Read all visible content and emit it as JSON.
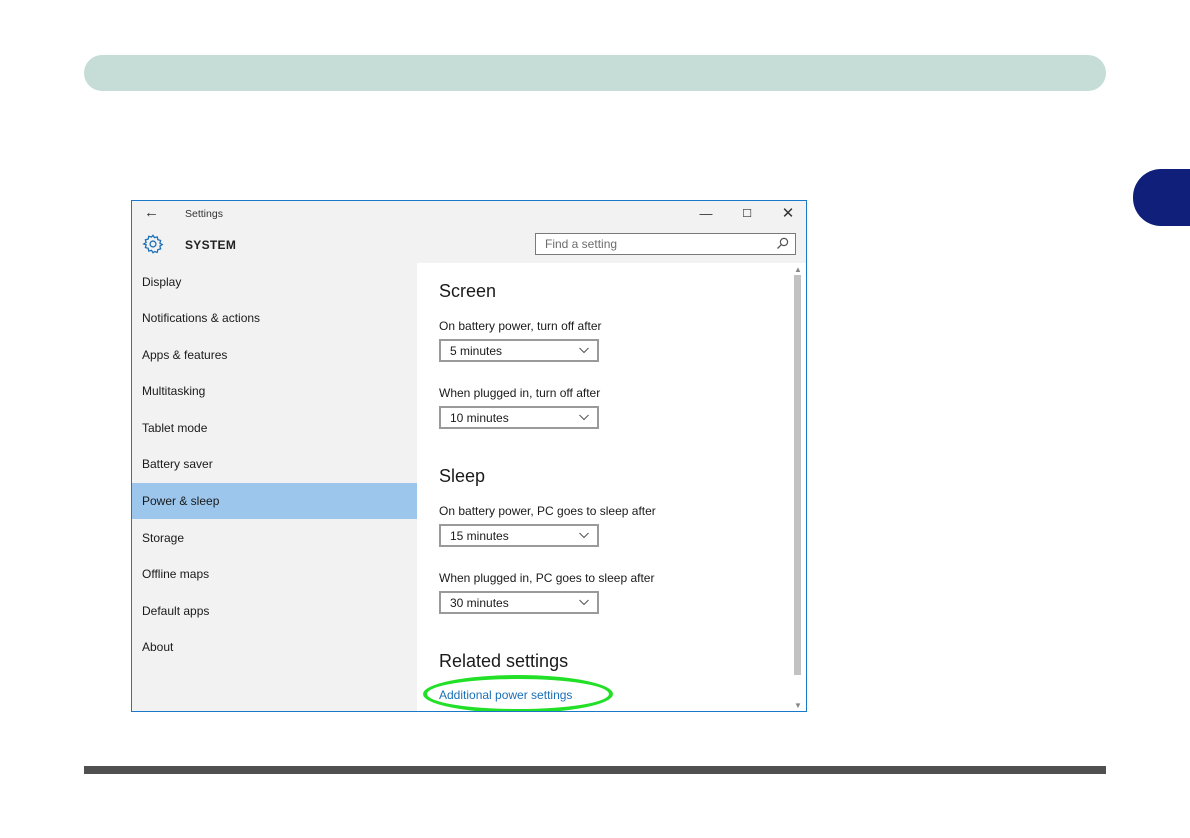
{
  "colors": {
    "top_bar": "#c5dcd7",
    "side_tab": "#0f1f7a",
    "window_border": "#1a78c8",
    "active_nav": "#9cc6ec",
    "link": "#1a6fb8",
    "highlight": "#22e027"
  },
  "window": {
    "title": "Settings",
    "back_icon": "arrow-left-icon",
    "minimize_glyph": "—",
    "maximize_glyph": "☐",
    "close_glyph": "✕"
  },
  "header": {
    "icon": "gear-icon",
    "section": "SYSTEM",
    "search": {
      "placeholder": "Find a setting",
      "value": ""
    }
  },
  "sidebar": {
    "active_index": 6,
    "items": [
      {
        "label": "Display"
      },
      {
        "label": "Notifications & actions"
      },
      {
        "label": "Apps & features"
      },
      {
        "label": "Multitasking"
      },
      {
        "label": "Tablet mode"
      },
      {
        "label": "Battery saver"
      },
      {
        "label": "Power & sleep"
      },
      {
        "label": "Storage"
      },
      {
        "label": "Offline maps"
      },
      {
        "label": "Default apps"
      },
      {
        "label": "About"
      }
    ]
  },
  "main": {
    "screen": {
      "title": "Screen",
      "battery_label": "On battery power, turn off after",
      "battery_value": "5 minutes",
      "plugged_label": "When plugged in, turn off after",
      "plugged_value": "10 minutes"
    },
    "sleep": {
      "title": "Sleep",
      "battery_label": "On battery power, PC goes to sleep after",
      "battery_value": "15 minutes",
      "plugged_label": "When plugged in, PC goes to sleep after",
      "plugged_value": "30 minutes"
    },
    "related": {
      "title": "Related settings",
      "link": "Additional power settings"
    }
  }
}
